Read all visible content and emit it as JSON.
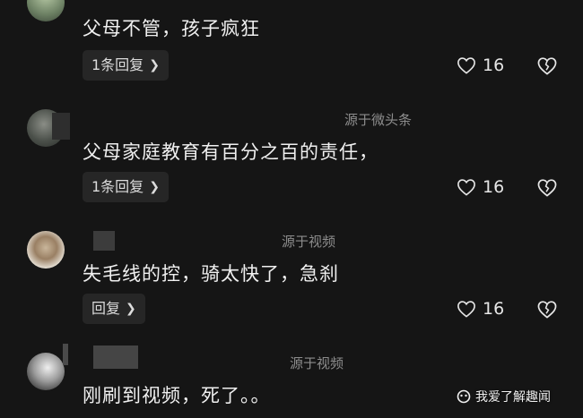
{
  "comments": [
    {
      "text": "父母不管，孩子疯狂",
      "source": "",
      "reply_label": "1条回复",
      "like_count": "16"
    },
    {
      "text": "父母家庭教育有百分之百的责任，",
      "source": "源于微头条",
      "reply_label": "1条回复",
      "like_count": "16"
    },
    {
      "text": "失毛线的控，骑太快了，急刹",
      "source": "源于视频",
      "reply_label": "回复",
      "like_count": "16"
    },
    {
      "text": "刚刷到视频，死了。。",
      "source": "源于视频"
    }
  ],
  "icons": {
    "like": "heart-outline-icon",
    "dislike": "broken-heart-icon",
    "chevron": "chevron-right-icon"
  },
  "watermark": {
    "text": "我爱了解趣闻"
  },
  "colors": {
    "background": "#151515",
    "reply_bg": "#262626",
    "source_text": "#8d8d8d"
  }
}
